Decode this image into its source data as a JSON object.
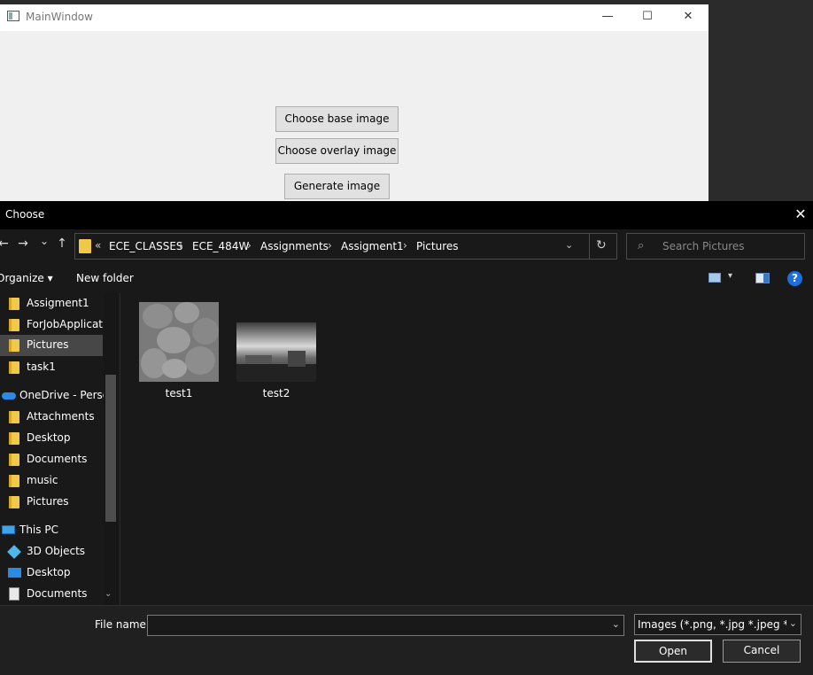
{
  "main_window": {
    "title": "MainWindow",
    "controls": {
      "minimize": "—",
      "maximize": "☐",
      "close": "✕"
    },
    "buttons": {
      "choose_base": "Choose base image",
      "choose_overlay": "Choose overlay image",
      "generate": "Generate image"
    }
  },
  "dialog": {
    "title": "Choose",
    "close": "✕",
    "nav": {
      "back": "←",
      "forward": "→",
      "recent": "⌄",
      "up": "↑"
    },
    "address": {
      "overflow": "«",
      "crumbs": [
        "ECE_CLASSES",
        "ECE_484W",
        "Assignments",
        "Assigment1",
        "Pictures"
      ],
      "separator": "›",
      "dropdown": "⌄",
      "refresh": "↻"
    },
    "search": {
      "placeholder": "Search Pictures",
      "icon": "⌕"
    },
    "command_bar": {
      "organize": "Organize ▾",
      "new_folder": "New folder",
      "view_icon": "▾",
      "help": "?"
    },
    "nav_pane": {
      "items": [
        "Assigment1",
        "ForJobApplicatio",
        "Pictures",
        "task1",
        "OneDrive - Person",
        "Attachments",
        "Desktop",
        "Documents",
        "music",
        "Pictures",
        "This PC",
        "3D Objects",
        "Desktop",
        "Documents"
      ],
      "scroll_down": "⌄"
    },
    "files": [
      {
        "name": "test1"
      },
      {
        "name": "test2"
      }
    ],
    "bottom": {
      "file_name_label": "File name:",
      "file_name_value": "",
      "file_name_dd": "⌄",
      "filter": "Images (*.png, *.jpg *.jpeg *.bmp)",
      "filter_dd": "⌄",
      "open": "Open",
      "cancel": "Cancel"
    }
  },
  "colors": {
    "folder": "#f0c94b",
    "dialog_bg": "#191919",
    "selected": "#474747"
  }
}
